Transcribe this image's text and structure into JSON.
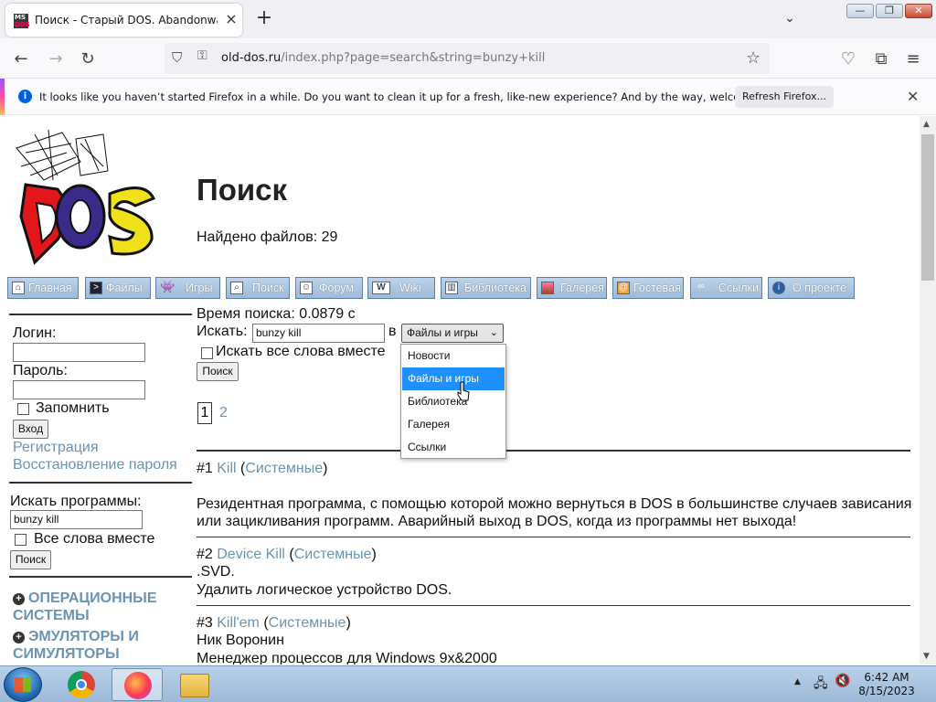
{
  "browser": {
    "tab_title": "Поиск - Старый DOS. Abandonware",
    "tab_icon": "msdos-favicon",
    "url_domain": "old-dos.ru",
    "url_path": "/index.php?page=search&string=bunzy+kill",
    "notification": "It looks like you haven’t started Firefox in a while. Do you want to clean it up for a fresh, like-new experience? And by the way, welcome back!",
    "notification_button": "Refresh Firefox..."
  },
  "page": {
    "title": "Поиск",
    "found_files": "Найдено файлов: 29",
    "search_time": "Время поиска: 0.0879 с",
    "search_label": "Искать:",
    "search_value": "bunzy kill",
    "in_label": "в",
    "scope_selected": "Файлы и игры",
    "scope_options": [
      "Новости",
      "Файлы и игры",
      "Библиотека",
      "Галерея",
      "Ссылки"
    ],
    "all_words_label": "Искать все слова вместе",
    "search_button": "Поиск",
    "pages": [
      "1",
      "2"
    ]
  },
  "menu": [
    {
      "label": "Главная",
      "icon": "home-icon"
    },
    {
      "label": "Файлы",
      "icon": "terminal-icon"
    },
    {
      "label": "Игры",
      "icon": "invader-icon"
    },
    {
      "label": "Поиск",
      "icon": "magnifier-icon"
    },
    {
      "label": "Форум",
      "icon": "user-icon"
    },
    {
      "label": "Wiki",
      "icon": "wiki-icon"
    },
    {
      "label": "Библиотека",
      "icon": "book-icon"
    },
    {
      "label": "Галерея",
      "icon": "picture-icon"
    },
    {
      "label": "Гостевая",
      "icon": "guestbook-icon"
    },
    {
      "label": "Ссылки",
      "icon": "link-icon"
    },
    {
      "label": "О проекте",
      "icon": "info-icon"
    }
  ],
  "sidebar": {
    "login_label": "Логин:",
    "password_label": "Пароль:",
    "remember_label": "Запомнить",
    "login_button": "Вход",
    "register_link": "Регистрация",
    "restore_link": "Восстановление пароля",
    "search_programs_label": "Искать программы:",
    "search_programs_value": "bunzy kill",
    "all_words_label": "Все слова вместе",
    "search_button": "Поиск",
    "categories": [
      "ОПЕРАЦИОННЫЕ СИСТЕМЫ",
      "ЭМУЛЯТОРЫ И СИМУЛЯТОРЫ"
    ]
  },
  "results": [
    {
      "num": "#1",
      "name": "Kill",
      "category": "Системные",
      "author": "",
      "description": "Резидентная программа, с помощью которой можно вернуться в DOS в большинстве случаев зависания или зацикливания программ. Аварийный выход в DOS, когда из программы нет выхода!"
    },
    {
      "num": "#2",
      "name": "Device Kill",
      "category": "Системные",
      "author": ".SVD.",
      "description": "Удалить логическое устройство DOS."
    },
    {
      "num": "#3",
      "name": "Kill'em",
      "category": "Системные",
      "author": "Ник Воронин",
      "description": "Менеджер процессов для Windows 9x&2000"
    }
  ],
  "taskbar": {
    "time": "6:42 AM",
    "date": "8/15/2023"
  },
  "colors": {
    "link": "#6a94b4",
    "menu_button": "#a9c4e0",
    "selected_option": "#1e90ff"
  }
}
